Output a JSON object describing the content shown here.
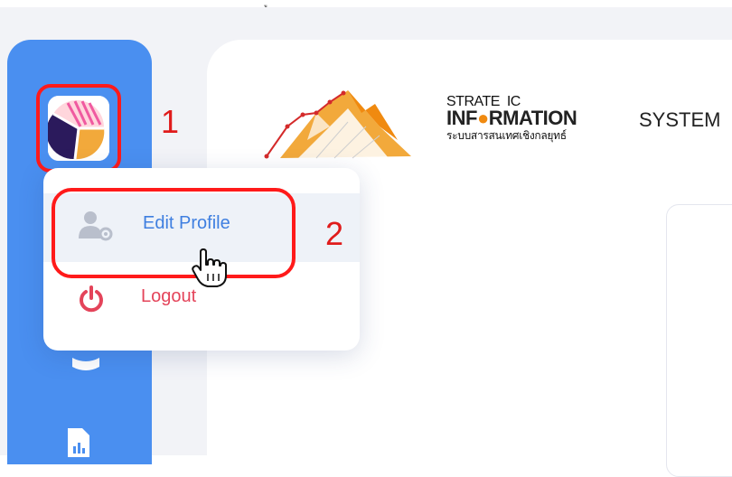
{
  "colors": {
    "sidebar": "#4a8ff0",
    "highlight_red": "#ff1a1a",
    "edit_text": "#3f7fe0",
    "logout_text": "#e4445a",
    "logo_orange": "#f08a10",
    "background": "#f2f3f7"
  },
  "annotations": {
    "step1": "1",
    "step2": "2"
  },
  "logo": {
    "line1": "STRATE  IC",
    "info_prefix": "INF",
    "info_orange": "●",
    "info_suffix": "RMATION",
    "system": "SYSTEM",
    "thai": "ระบบสารสนเทศเชิงกลยุทธ์"
  },
  "menu": {
    "edit_profile": "Edit Profile",
    "logout": "Logout"
  },
  "icons": {
    "avatar": "avatar",
    "user_gear": "user-gear-icon",
    "power": "power-icon",
    "cursor": "hand-pointer-icon"
  }
}
